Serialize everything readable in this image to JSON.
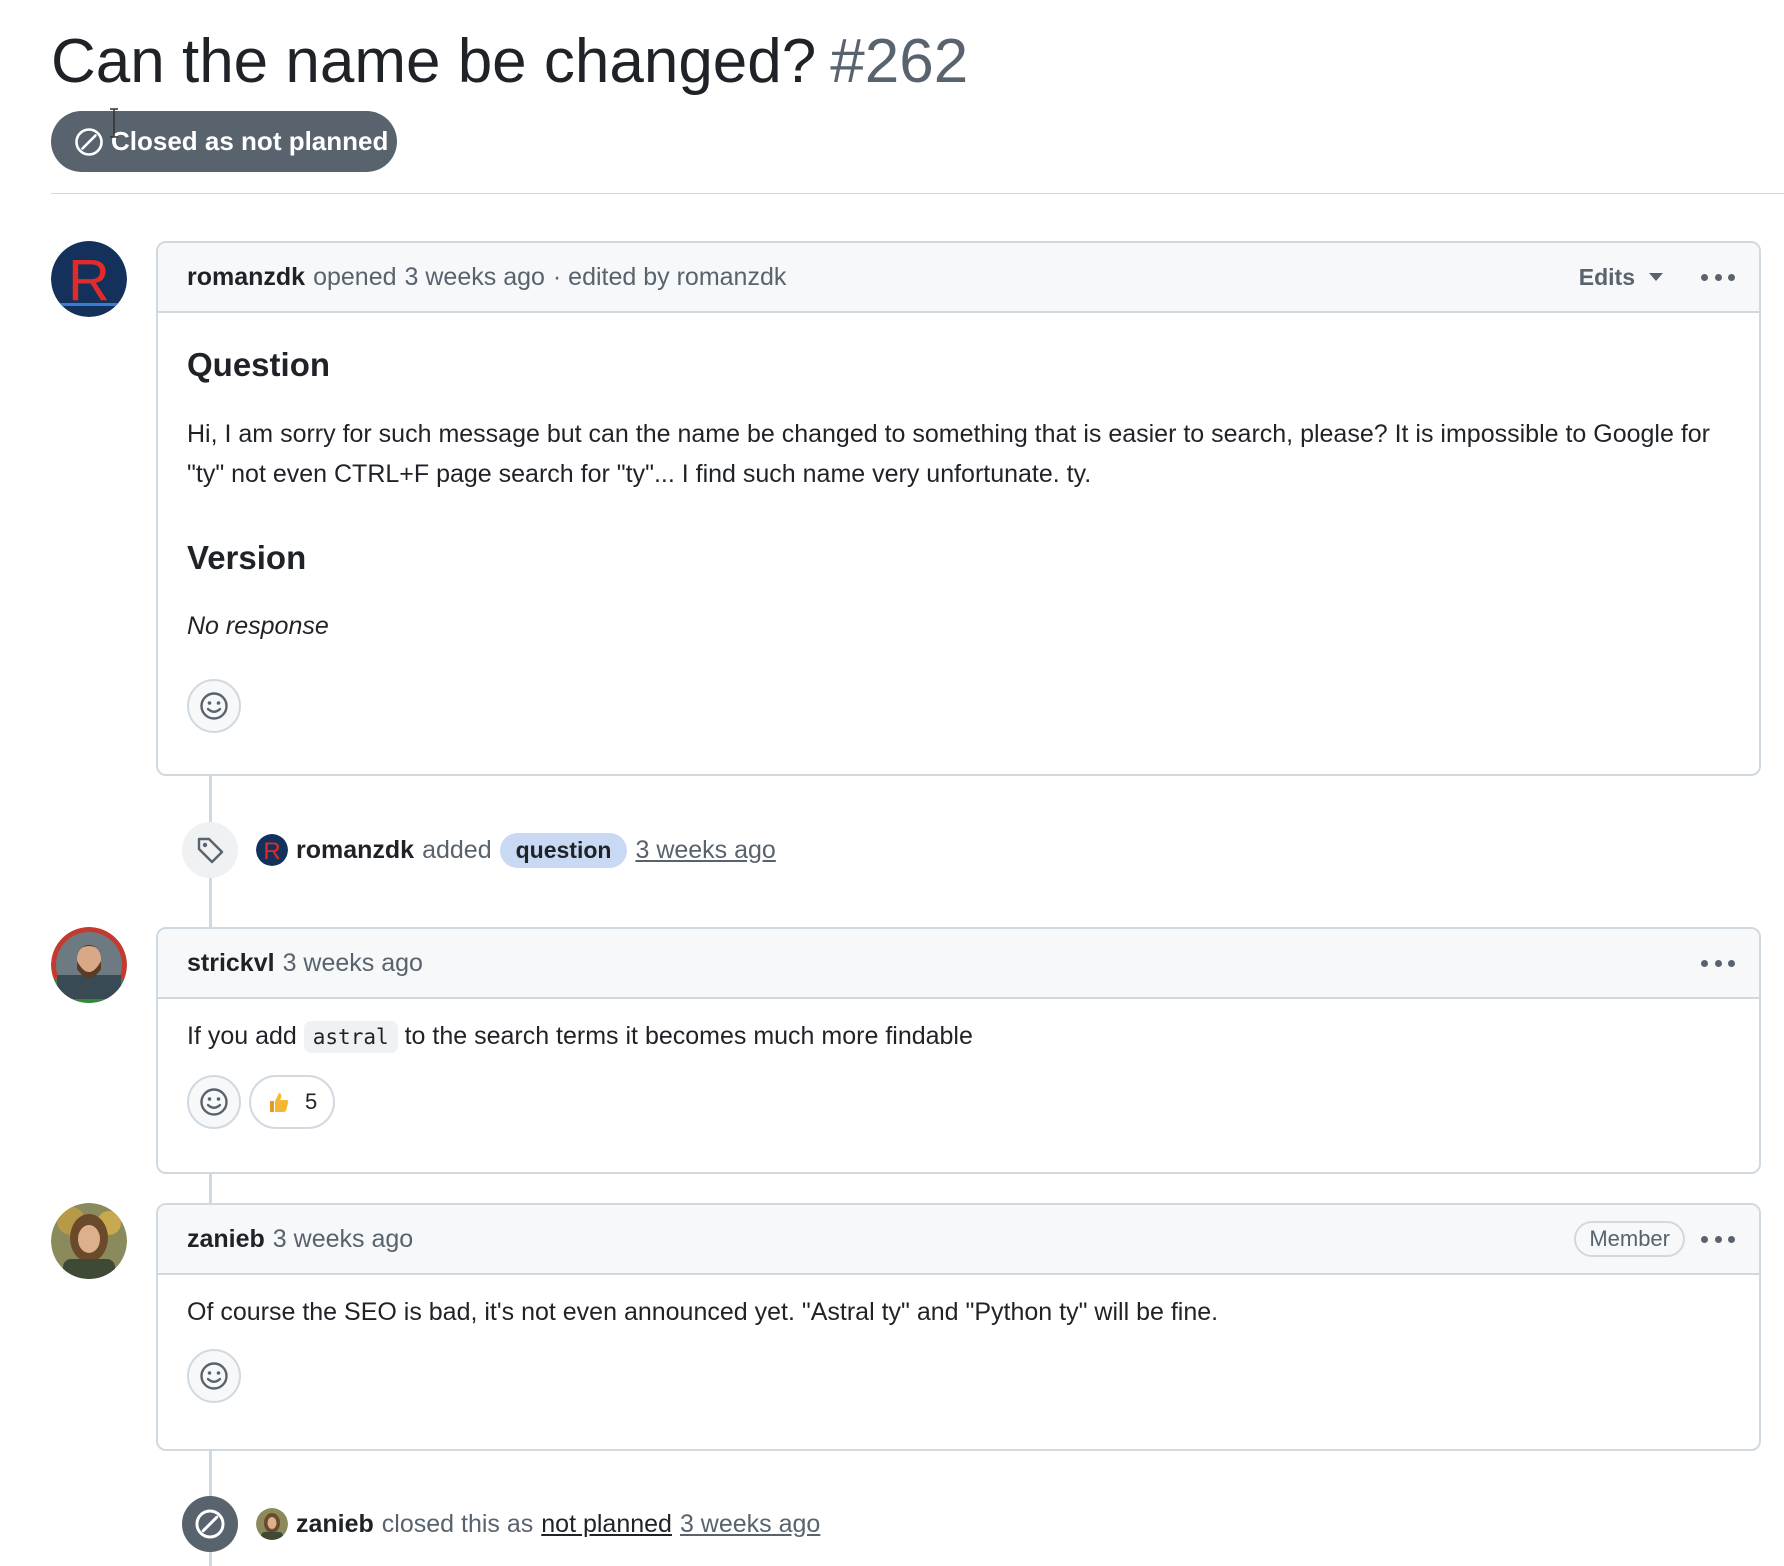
{
  "issue": {
    "title": "Can the name be changed?",
    "number": "#262",
    "state_label": "Closed as not planned",
    "state_color": "#59636e"
  },
  "comments": [
    {
      "author": "romanzdk",
      "action": "opened",
      "time": "3 weeks ago",
      "edited_text": "· edited by romanzdk",
      "edits_label": "Edits",
      "heading_question": "Question",
      "body": "Hi, I am sorry for such message but can the name be changed to something that is easier to search, please? It is impossible to Google for \"ty\" not even CTRL+F page search for \"ty\"... I find such name very unfortunate. ty.",
      "heading_version": "Version",
      "version_value": "No response"
    },
    {
      "author": "strickvl",
      "time": "3 weeks ago",
      "body_before": "If you add",
      "body_code": "astral",
      "body_after": "to the search terms it becomes much more findable",
      "reaction_count": "5"
    },
    {
      "author": "zanieb",
      "time": "3 weeks ago",
      "role_badge": "Member",
      "body": "Of course the SEO is bad, it's not even announced yet. \"Astral ty\" and \"Python ty\" will be fine."
    }
  ],
  "events": [
    {
      "actor": "romanzdk",
      "action": "added",
      "label": "question",
      "label_color": "#c9d9f4",
      "time": "3 weeks ago",
      "icon": "tag-icon"
    },
    {
      "actor": "zanieb",
      "action": "closed this as",
      "reason": "not planned",
      "time": "3 weeks ago",
      "icon": "skip-icon"
    }
  ],
  "colors": {
    "brand_avatar_bg": "#14315c",
    "brand_avatar_letter": "#e02b2b",
    "border": "#d1d9e0",
    "muted_text": "#59636e"
  }
}
